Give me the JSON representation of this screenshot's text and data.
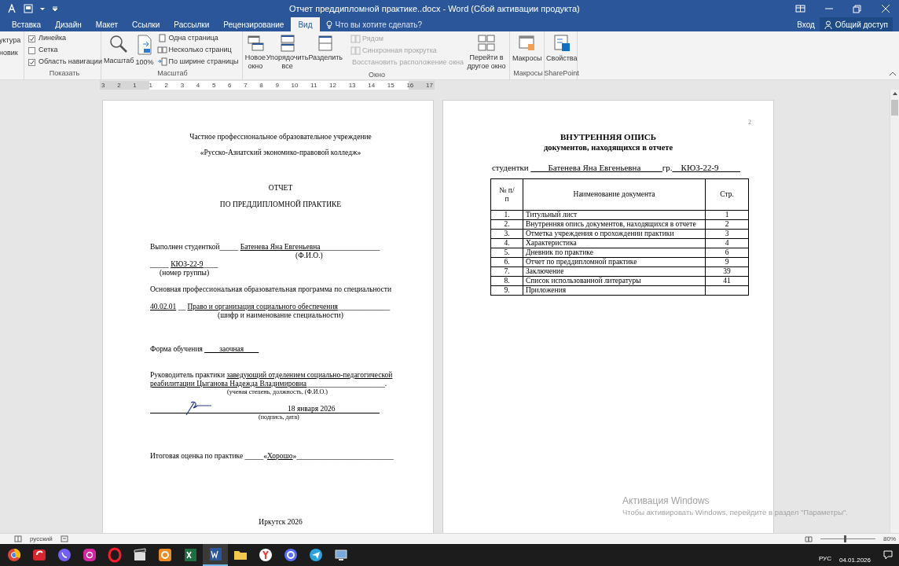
{
  "title_bar": {
    "title": "Отчет преддипломной практике..docx - Word (Сбой активации продукта)",
    "sign_in": "Вход",
    "share": "Общий доступ"
  },
  "tabs": [
    {
      "label": "Вставка",
      "selected": false
    },
    {
      "label": "Дизайн",
      "selected": false
    },
    {
      "label": "Макет",
      "selected": false
    },
    {
      "label": "Ссылки",
      "selected": false
    },
    {
      "label": "Рассылки",
      "selected": false
    },
    {
      "label": "Рецензирование",
      "selected": false
    },
    {
      "label": "Вид",
      "selected": true
    }
  ],
  "tell_me": {
    "placeholder": "Что вы хотите сделать?"
  },
  "ribbon": {
    "cut_group": {
      "items": [
        "уктура",
        "новик"
      ]
    },
    "show_group": {
      "label": "Показать",
      "checkboxes": [
        {
          "label": "Линейка",
          "checked": true
        },
        {
          "label": "Сетка",
          "checked": false
        },
        {
          "label": "Область навигации",
          "checked": true
        }
      ]
    },
    "zoom_group": {
      "label": "Масштаб",
      "large_buttons": [
        "Масштаб",
        "100%"
      ],
      "small_buttons": [
        "Одна страница",
        "Несколько страниц",
        "По ширине страницы"
      ]
    },
    "window_group": {
      "label": "Окно",
      "large_buttons": [
        "Новое окно",
        "Упорядочить все",
        "Разделить"
      ],
      "small_buttons": [
        {
          "label": "Рядом",
          "disabled": true
        },
        {
          "label": "Синхронная прокрутка",
          "disabled": true
        },
        {
          "label": "Восстановить расположение окна",
          "disabled": true
        }
      ],
      "switch_button": "Перейти в другое окно"
    },
    "macros_group": {
      "label": "Макросы",
      "button": "Макросы"
    },
    "sharepoint_group": {
      "label": "SharePoint",
      "button": "Свойства"
    }
  },
  "ruler": {
    "labels": [
      "3",
      "2",
      "1",
      "1",
      "2",
      "3",
      "4",
      "5",
      "6",
      "7",
      "8",
      "9",
      "10",
      "11",
      "12",
      "13",
      "14",
      "15",
      "16",
      "17"
    ]
  },
  "title_page": {
    "institution": "Частное профессиональное образовательное учреждение",
    "college": "«Русско-Азиатский экономико-правовой колледж»",
    "title": "ОТЧЕТ",
    "subtitle": "ПО ПРЕДДИПЛОМНОЙ ПРАКТИКЕ",
    "student_line": [
      {
        "text": "Выполнен студенткой_____ ",
        "underline": false
      },
      {
        "text": "Батенева Яна Евгеньевна",
        "underline": true
      },
      {
        "text": "________________",
        "underline": false
      }
    ],
    "fio_caption": "(Ф.И.О.)",
    "group_line": [
      {
        "text": "_____ ",
        "underline": false
      },
      {
        "text": "КЮЗ-22-9",
        "underline": true
      },
      {
        "text": "____",
        "underline": false
      }
    ],
    "group_caption": "(номер группы)",
    "program": "Основная профессиональная образовательная программа по специальности",
    "specialty_line": [
      {
        "text": "40.02.01",
        "underline": true
      },
      {
        "text": " __ ",
        "underline": false
      },
      {
        "text": "Право и организация социального обеспечения",
        "underline": true
      },
      {
        "text": "______________",
        "underline": false
      }
    ],
    "specialty_caption": "(шифр и наименование специальности)",
    "study_form": [
      {
        "text": "Форма обучения ",
        "underline": false
      },
      {
        "text": "____заочная____",
        "underline": true
      }
    ],
    "supervisor": [
      {
        "text": "Руководитель практики ",
        "underline": false
      },
      {
        "text": "заведующий отделением социально-педагогической реабилитации Цыганова Надежда Владимировна",
        "underline": true
      },
      {
        "text": "_____________________.",
        "underline": false
      }
    ],
    "supervisor_caption": "(ученая степень, должность, (Ф.И.О.)",
    "signature_date": "18 января 2026",
    "signature_caption": "(подпись, дата)",
    "grade": [
      {
        "text": "Итоговая оценка по практике _____«",
        "underline": false
      },
      {
        "text": "Хорошо",
        "underline": true
      },
      {
        "text": "»__________________________",
        "underline": false
      }
    ],
    "city_year": "Иркутск 2026"
  },
  "inventory_page": {
    "page_number": "2",
    "heading": "ВНУТРЕННЯЯ ОПИСЬ",
    "subheading": "документов, находящихся в отчете",
    "student_line": [
      {
        "text": "студентки ",
        "underline": false
      },
      {
        "text": "____Батенева Яна Евгеньевна_____",
        "underline": true
      },
      {
        "text": "гр.",
        "underline": false
      },
      {
        "text": "__КЮЗ-22-9_____",
        "underline": true
      }
    ],
    "table": {
      "columns": [
        "№ п/п",
        "Наименование документа",
        "Стр."
      ],
      "rows": [
        [
          "1.",
          "Титульный лист",
          "1"
        ],
        [
          "2.",
          "Внутренняя опись документов, находящихся в отчете",
          "2"
        ],
        [
          "3.",
          "Отметка учреждения о прохождении практики",
          "3"
        ],
        [
          "4.",
          "Характеристика",
          "4"
        ],
        [
          "5.",
          "Дневник по практике",
          "6"
        ],
        [
          "6.",
          "Отчет по преддипломной практике",
          "9"
        ],
        [
          "7.",
          "Заключение",
          "39"
        ],
        [
          "8.",
          "Список использованной литературы",
          "41"
        ],
        [
          "9.",
          "Приложения",
          ""
        ]
      ]
    }
  },
  "activation": {
    "title": "Активация Windows",
    "message": "Чтобы активировать Windows, перейдите в раздел \"Параметры\"."
  },
  "status_bar": {
    "language": "русский",
    "zoom_slider": {
      "level": 0.45
    },
    "zoom": "80%"
  },
  "taskbar": {
    "language": "РУС",
    "date": "04.01.2026"
  }
}
